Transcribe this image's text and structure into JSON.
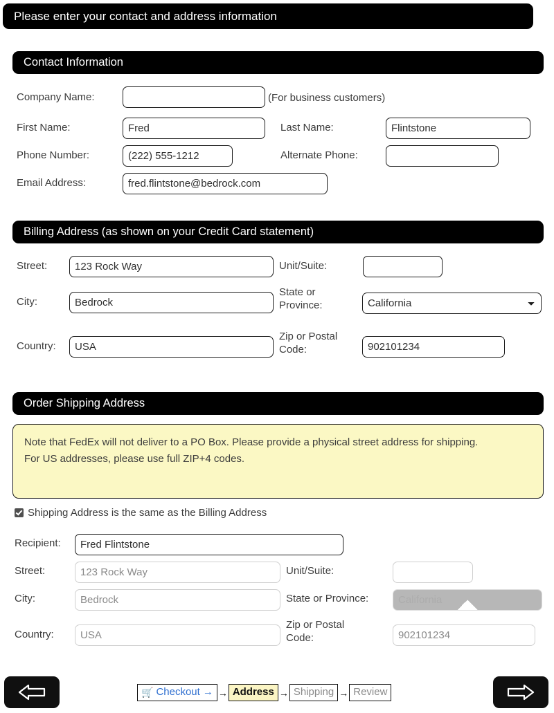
{
  "page": {
    "banner": "Please enter your contact and address information"
  },
  "contact": {
    "heading": "Contact Information",
    "company_label": "Company Name:",
    "company_value": "",
    "company_hint": "(For business customers)",
    "first_name_label": "First Name:",
    "first_name_value": "Fred",
    "last_name_label": "Last Name:",
    "last_name_value": "Flintstone",
    "phone_label": "Phone Number:",
    "phone_value": "(222) 555-1212",
    "alt_phone_label": "Alternate Phone:",
    "alt_phone_value": "",
    "email_label": "Email Address:",
    "email_value": "fred.flintstone@bedrock.com"
  },
  "billing": {
    "heading": "Billing Address (as shown on your Credit Card statement)",
    "street_label": "Street:",
    "street_value": "123 Rock Way",
    "unit_label": "Unit/Suite:",
    "unit_value": "",
    "city_label": "City:",
    "city_value": "Bedrock",
    "state_label": "State or\nProvince:",
    "state_value": "California",
    "country_label": "Country:",
    "country_value": "USA",
    "zip_label": "Zip or Postal\nCode:",
    "zip_value": "902101234"
  },
  "shipping": {
    "heading": "Order Shipping Address",
    "note_line1": "Note that FedEx will not deliver to a PO Box. Please provide a physical street address for shipping.",
    "note_line2": "For US addresses, please use full ZIP+4 codes.",
    "same_as_billing_label": "Shipping Address is the same as the Billing Address",
    "same_as_billing_checked": true,
    "recipient_label": "Recipient:",
    "recipient_value": "Fred Flintstone",
    "street_label": "Street:",
    "street_value": "123 Rock Way",
    "unit_label": "Unit/Suite:",
    "unit_value": "",
    "city_label": "City:",
    "city_value": "Bedrock",
    "state_label": "State or Province:",
    "state_value": "California",
    "country_label": "Country:",
    "country_value": "USA",
    "zip_label": "Zip or Postal\nCode:",
    "zip_value": "902101234"
  },
  "nav": {
    "prev_icon": "arrow-left-icon",
    "next_icon": "arrow-right-icon",
    "cart_icon": "shopping-cart-icon",
    "steps": [
      {
        "label": "Checkout",
        "trailing": "→",
        "state": "link"
      },
      {
        "label": "Address",
        "state": "current"
      },
      {
        "label": "Shipping",
        "state": "future"
      },
      {
        "label": "Review",
        "state": "future"
      }
    ],
    "separator": "→"
  },
  "colors": {
    "banner_bg": "#000000",
    "note_bg": "#fbf8c4",
    "current_step_bg": "#fbf5c4",
    "link": "#2f6fd0",
    "disabled_text": "#8a8a8a"
  }
}
